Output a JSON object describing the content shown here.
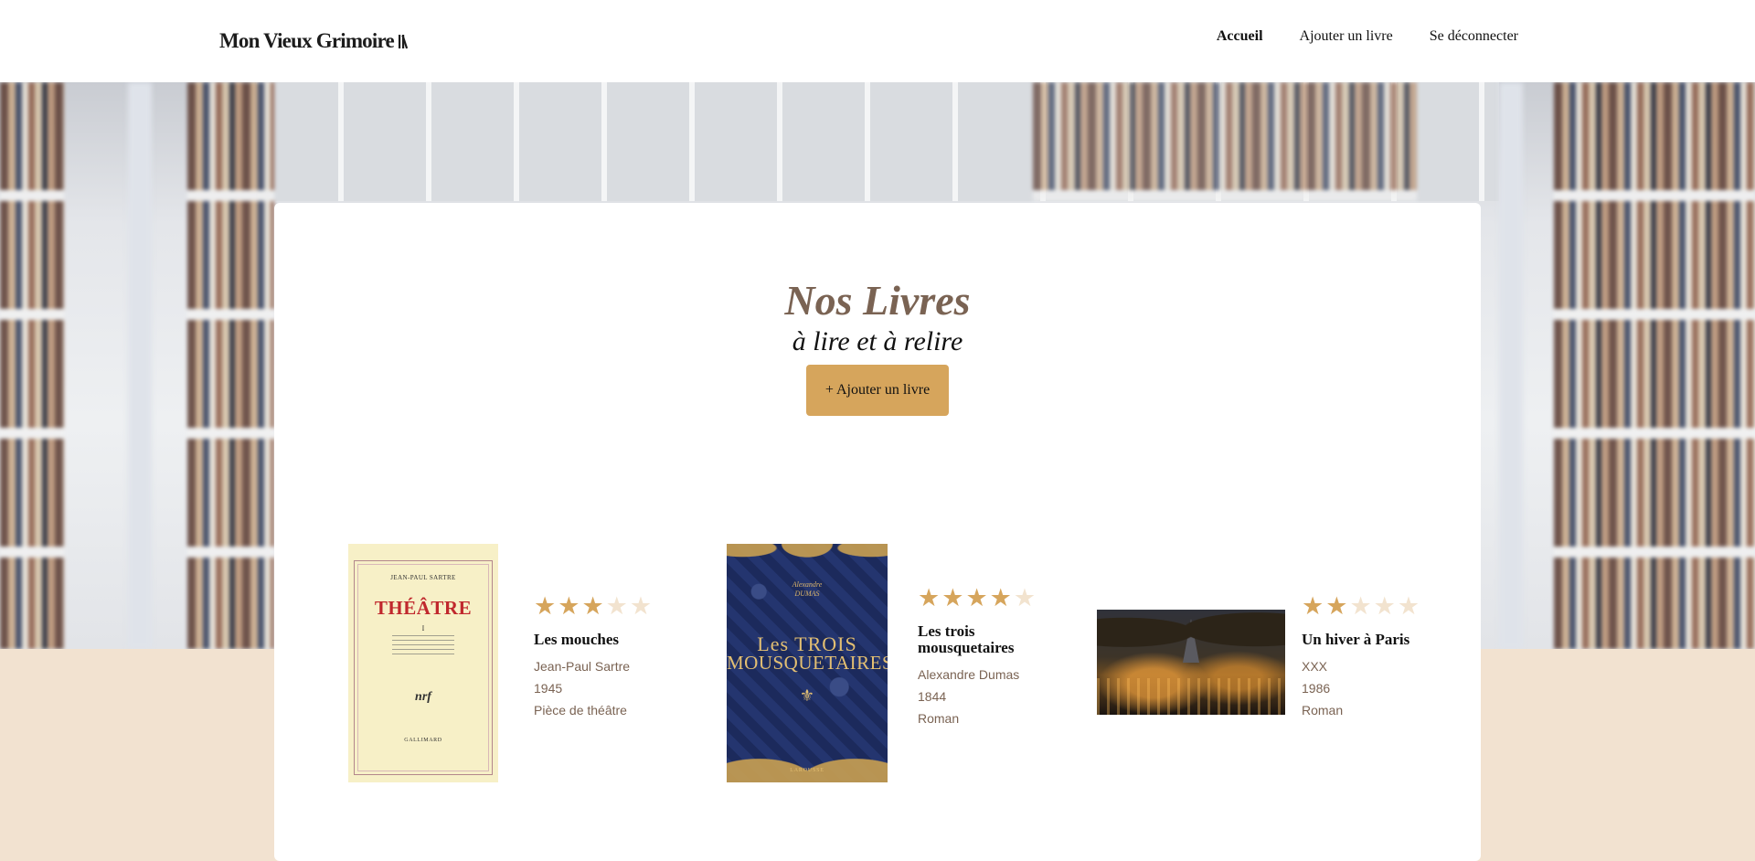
{
  "header": {
    "logo_text": "Mon Vieux Grimoire",
    "nav": [
      {
        "label": "Accueil",
        "active": true
      },
      {
        "label": "Ajouter un livre",
        "active": false
      },
      {
        "label": "Se déconnecter",
        "active": false
      }
    ]
  },
  "hero": {
    "title": "Nos Livres",
    "subtitle": "à lire et à relire",
    "add_button_label": "+ Ajouter un livre"
  },
  "books": [
    {
      "title": "Les mouches",
      "author": "Jean-Paul Sartre",
      "year": "1945",
      "genre": "Pièce de théâtre",
      "rating": 3,
      "max_rating": 5,
      "cover": {
        "author": "JEAN-PAUL SARTRE",
        "title": "THÉÂTRE",
        "volume": "I",
        "imprint": "nrf",
        "publisher": "GALLIMARD"
      }
    },
    {
      "title": "Les trois mousquetaires",
      "author": "Alexandre Dumas",
      "year": "1844",
      "genre": "Roman",
      "rating": 4,
      "max_rating": 5,
      "cover": {
        "author_first": "Alexandre",
        "author_last": "DUMAS",
        "title_top": "Les TROIS",
        "title_bottom": "MOUSQUETAIRES",
        "publisher": "LAROUSSE"
      }
    },
    {
      "title": "Un hiver à Paris",
      "author": "XXX",
      "year": "1986",
      "genre": "Roman",
      "rating": 2,
      "max_rating": 5
    }
  ],
  "colors": {
    "accent": "#d6a55c",
    "muted_text": "#7a6353",
    "page_bg": "#f2e2d0",
    "star_empty": "#f2e3cf"
  },
  "icons": [
    "book-stack-icon",
    "star-icon"
  ]
}
